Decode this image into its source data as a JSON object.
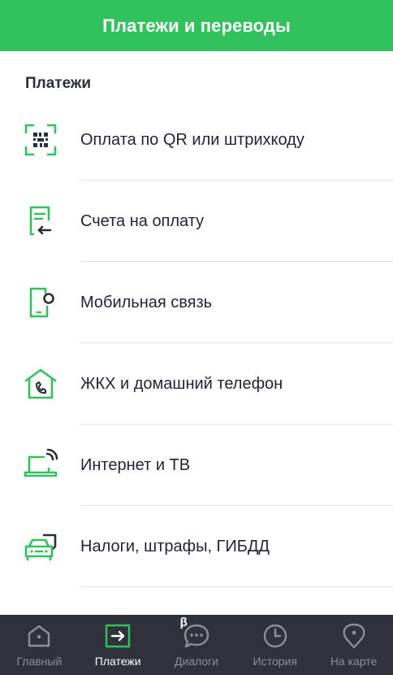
{
  "header": {
    "title": "Платежи и переводы"
  },
  "section": {
    "title": "Платежи"
  },
  "items": [
    {
      "label": "Оплата по QR или штрихкоду",
      "icon": "qr-code-icon"
    },
    {
      "label": "Счета на оплату",
      "icon": "invoice-icon"
    },
    {
      "label": "Мобильная связь",
      "icon": "mobile-phone-icon"
    },
    {
      "label": "ЖКХ и домашний телефон",
      "icon": "house-phone-icon"
    },
    {
      "label": "Интернет и ТВ",
      "icon": "laptop-wifi-icon"
    },
    {
      "label": "Налоги, штрафы, ГИБДД",
      "icon": "car-icon"
    }
  ],
  "tabbar": {
    "tabs": [
      {
        "label": "Главный",
        "icon": "home-icon",
        "active": false
      },
      {
        "label": "Платежи",
        "icon": "payments-arrow-icon",
        "active": true
      },
      {
        "label": "Диалоги",
        "icon": "chat-icon",
        "active": false,
        "badge": "β"
      },
      {
        "label": "История",
        "icon": "clock-icon",
        "active": false
      },
      {
        "label": "На карте",
        "icon": "map-pin-icon",
        "active": false
      }
    ]
  },
  "colors": {
    "accent": "#31c25d",
    "tabbar_bg": "#2f323a",
    "tab_inactive": "#8b8f98",
    "tab_active": "#ffffff"
  }
}
